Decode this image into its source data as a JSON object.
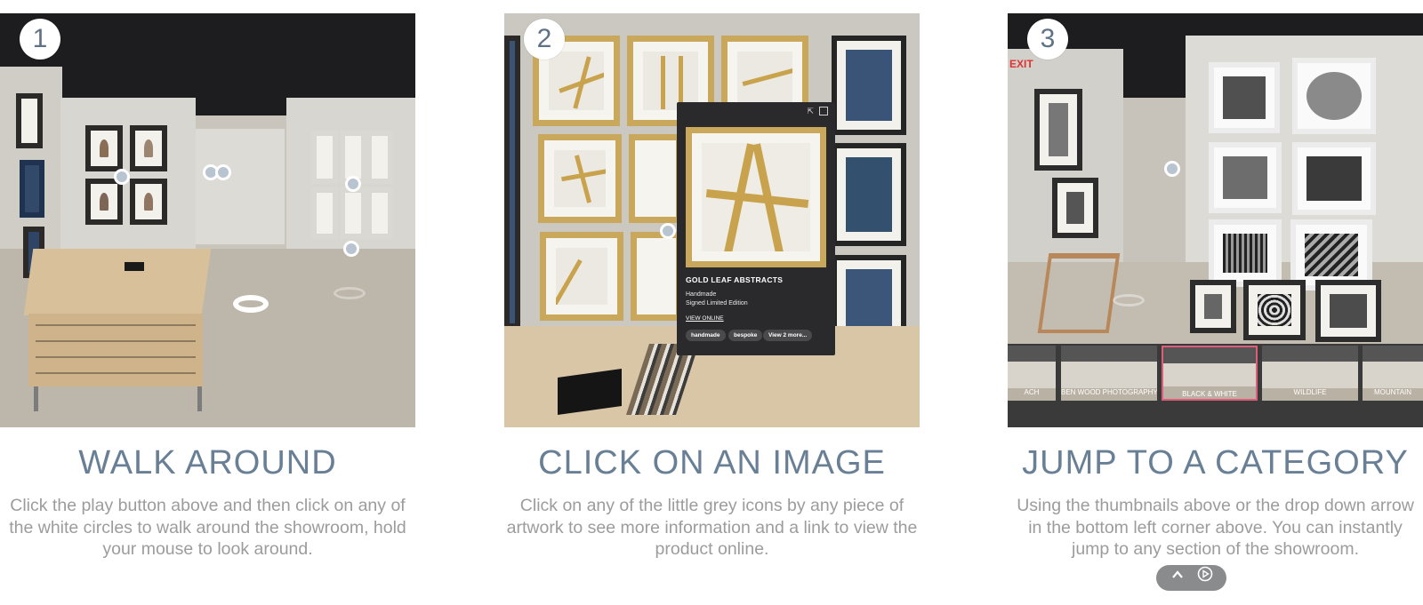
{
  "steps": [
    {
      "number": "1",
      "title": "WALK AROUND",
      "description": "Click the play button above and then click on any of the white circles to walk around the showroom, hold your mouse to look around."
    },
    {
      "number": "2",
      "title": "CLICK ON AN IMAGE",
      "description": "Click on any of the little grey icons by any piece of artwork to see more information and a link to view the product online."
    },
    {
      "number": "3",
      "title": "JUMP TO A CATEGORY",
      "description": "Using the thumbnails above or the drop down arrow in the bottom left corner above. You can instantly jump to any section of the showroom."
    }
  ],
  "popup": {
    "title": "GOLD LEAF ABSTRACTS",
    "line1": "Handmade",
    "line2": "Signed Limited Edition",
    "link": "VIEW ONLINE",
    "tags": [
      "handmade",
      "bespoke",
      "View 2 more..."
    ]
  },
  "scene3": {
    "exit_sign": "EXIT",
    "thumbnails": [
      "ACH",
      "BEN WOOD PHOTOGRAPHY",
      "BLACK & WHITE",
      "WILDLIFE",
      "MOUNTAIN"
    ],
    "active_thumbnail": "BLACK & WHITE"
  },
  "controls": {
    "up_icon": "chevron-up-icon",
    "play_icon": "play-circle-icon"
  },
  "colors": {
    "heading": "#687f95",
    "description": "#9c9c9c",
    "popup_bg": "#2a2a2c",
    "active_thumb_border": "#e05c78"
  }
}
